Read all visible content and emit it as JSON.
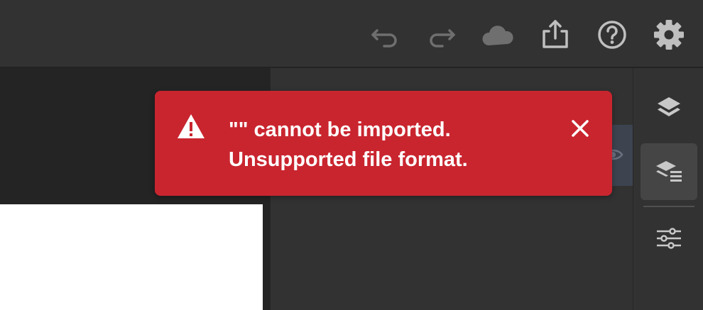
{
  "toolbar": {
    "icons": [
      "undo-icon",
      "redo-icon",
      "cloud-icon",
      "share-icon",
      "help-icon",
      "settings-icon"
    ]
  },
  "toast": {
    "line1": "\"\" cannot be imported.",
    "line2": "Unsupported file format.",
    "icon": "alert-triangle-icon",
    "close_icon": "close-icon",
    "color": "#c9252f"
  },
  "rail": {
    "icons": [
      "layers-icon",
      "layer-properties-icon",
      "adjustments-icon"
    ],
    "active": "layer-properties-icon"
  },
  "colors": {
    "background": "#2b2b2b",
    "panel": "#323232",
    "selection": "#3d4450"
  }
}
